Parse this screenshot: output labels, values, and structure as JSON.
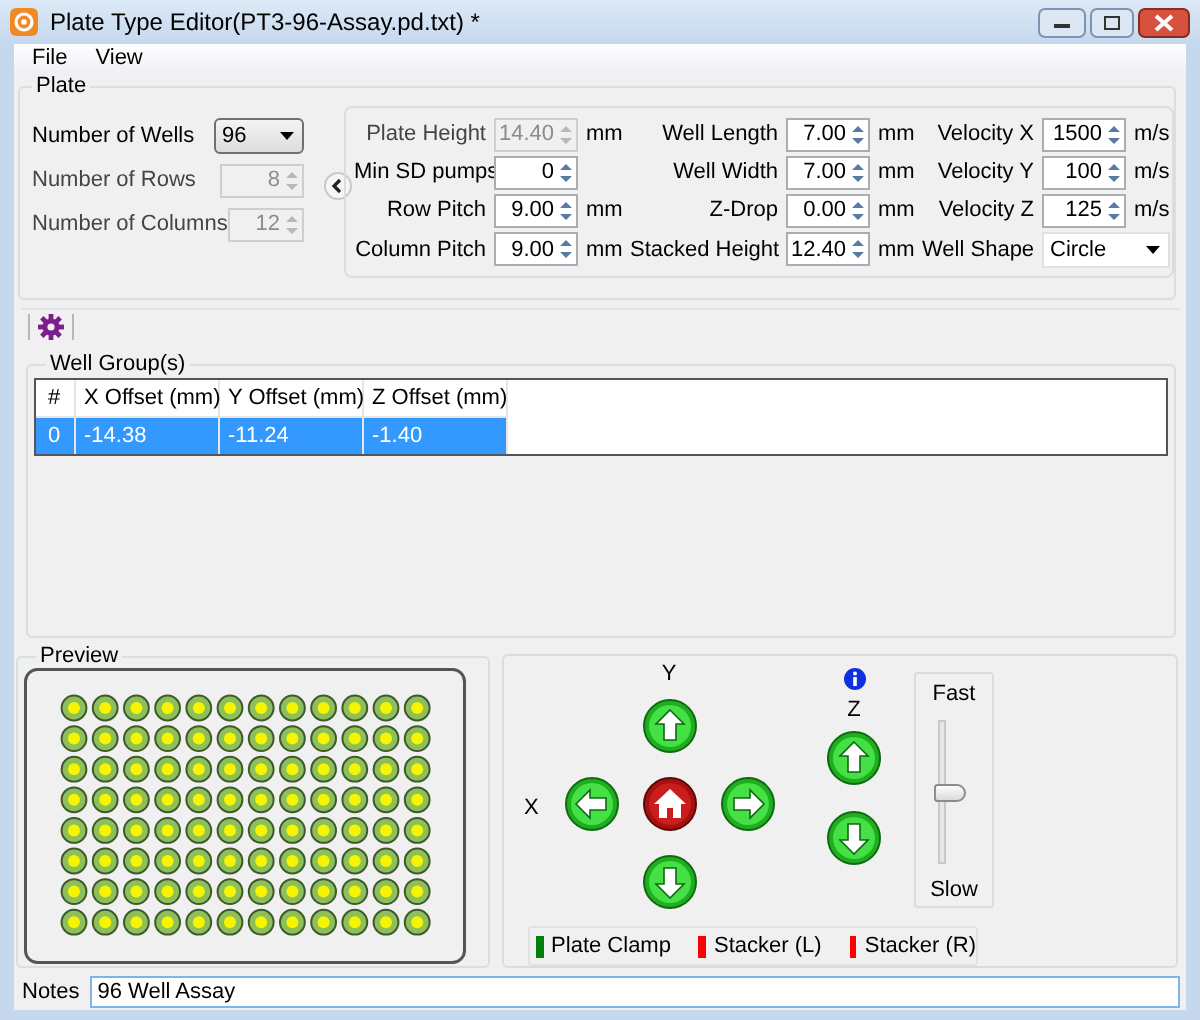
{
  "window": {
    "title": "Plate Type Editor(PT3-96-Assay.pd.txt) *"
  },
  "menu": [
    "File",
    "View"
  ],
  "plate": {
    "title": "Plate",
    "left_fields": [
      {
        "label": "Number of Wells",
        "value": "96",
        "kind": "combo",
        "disabled": false
      },
      {
        "label": "Number of Rows",
        "value": "8",
        "kind": "spin",
        "disabled": true
      },
      {
        "label": "Number of Columns",
        "value": "12",
        "kind": "spin",
        "disabled": true
      }
    ],
    "columns": [
      [
        {
          "label": "Plate Height",
          "value": "14.40",
          "unit": "mm",
          "kind": "spin",
          "disabled": true
        },
        {
          "label": "Min SD pumps",
          "value": "0",
          "kind": "spin",
          "disabled": false
        },
        {
          "label": "Row Pitch",
          "value": "9.00",
          "unit": "mm",
          "kind": "spin",
          "disabled": false
        },
        {
          "label": "Column Pitch",
          "value": "9.00",
          "unit": "mm",
          "kind": "spin",
          "disabled": false
        }
      ],
      [
        {
          "label": "Well Length",
          "value": "7.00",
          "unit": "mm",
          "kind": "spin",
          "disabled": false
        },
        {
          "label": "Well Width",
          "value": "7.00",
          "unit": "mm",
          "kind": "spin",
          "disabled": false
        },
        {
          "label": "Z-Drop",
          "value": "0.00",
          "unit": "mm",
          "kind": "spin",
          "disabled": false
        },
        {
          "label": "Stacked Height",
          "value": "12.40",
          "unit": "mm",
          "kind": "spin",
          "disabled": false
        }
      ],
      [
        {
          "label": "Velocity X",
          "value": "1500",
          "unit": "m/s",
          "kind": "spin",
          "disabled": false
        },
        {
          "label": "Velocity Y",
          "value": "100",
          "unit": "m/s",
          "kind": "spin",
          "disabled": false
        },
        {
          "label": "Velocity Z",
          "value": "125",
          "unit": "m/s",
          "kind": "spin",
          "disabled": false
        },
        {
          "label": "Well Shape",
          "value": "Circle",
          "kind": "combo",
          "disabled": false
        }
      ]
    ]
  },
  "well_groups": {
    "title": "Well Group(s)",
    "columns": [
      "#",
      "X Offset (mm)",
      "Y Offset (mm)",
      "Z Offset (mm)"
    ],
    "rows": [
      {
        "cells": [
          "0",
          "-14.38",
          "-11.24",
          "-1.40"
        ],
        "selected": true
      }
    ]
  },
  "preview": {
    "title": "Preview"
  },
  "jog": {
    "y_label": "Y",
    "x_label": "X",
    "z_label": "Z",
    "fast": "Fast",
    "slow": "Slow",
    "level": 0.5
  },
  "legend": [
    {
      "label": "Plate Clamp",
      "color": "#007f0e"
    },
    {
      "label": "Stacker (L)",
      "color": "#ff0000"
    },
    {
      "label": "Stacker (R)",
      "color": "#ff0000"
    }
  ],
  "notes": {
    "label": "Notes",
    "value": "96 Well Assay"
  }
}
